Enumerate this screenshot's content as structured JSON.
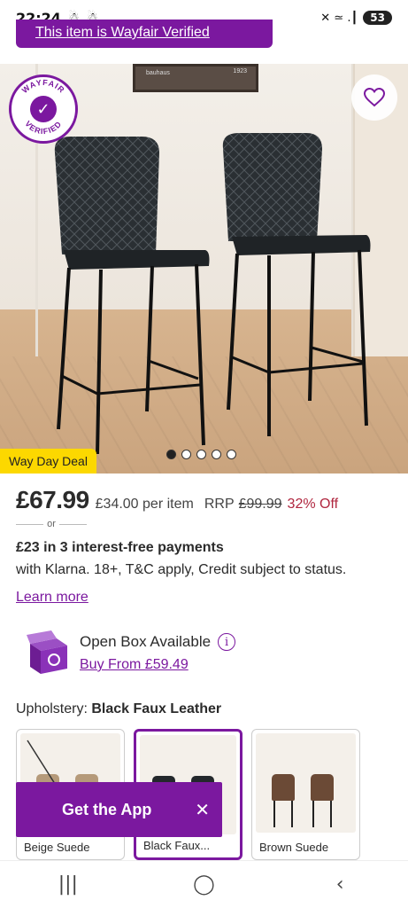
{
  "status_bar": {
    "time": "22:24",
    "left_icons": "☃ ☃",
    "right_icons": "✕ ≃ .┃",
    "battery": "53"
  },
  "verified_banner": {
    "text": "This item is Wayfair Verified"
  },
  "hero": {
    "seal_text_top": "WAYFAIR",
    "seal_text_bottom": "VERIFIED",
    "deal_badge": "Way Day Deal",
    "frame_text_left": "bauhaus",
    "frame_text_right": "1923",
    "carousel": {
      "total": 5,
      "active": 1
    }
  },
  "price": {
    "main": "£67.99",
    "per_item": "£34.00 per item",
    "rrp_label": "RRP",
    "rrp_value": "£99.99",
    "discount": "32% Off"
  },
  "or_text": "or",
  "klarna": {
    "title": "£23 in 3 interest-free payments",
    "description": "with Klarna. 18+, T&C apply, Credit subject to status.",
    "learn_more": "Learn more"
  },
  "open_box": {
    "title": "Open Box Available",
    "info_icon": "i",
    "link": "Buy From £59.49"
  },
  "upholstery": {
    "label": "Upholstery:",
    "selected": "Black Faux Leather"
  },
  "swatches": [
    {
      "label": "Beige Suede",
      "color": "#b59a7a"
    },
    {
      "label": "Black Faux...",
      "color": "#23282c"
    },
    {
      "label": "Brown Suede",
      "color": "#6b4a36"
    }
  ],
  "get_app": {
    "label": "Get the App",
    "close": "✕"
  },
  "nav": {
    "recent": "|||",
    "home": "◯",
    "back": "‹"
  },
  "colors": {
    "accent": "#7b189f",
    "deal": "#fcd800",
    "discount": "#b0263f"
  }
}
